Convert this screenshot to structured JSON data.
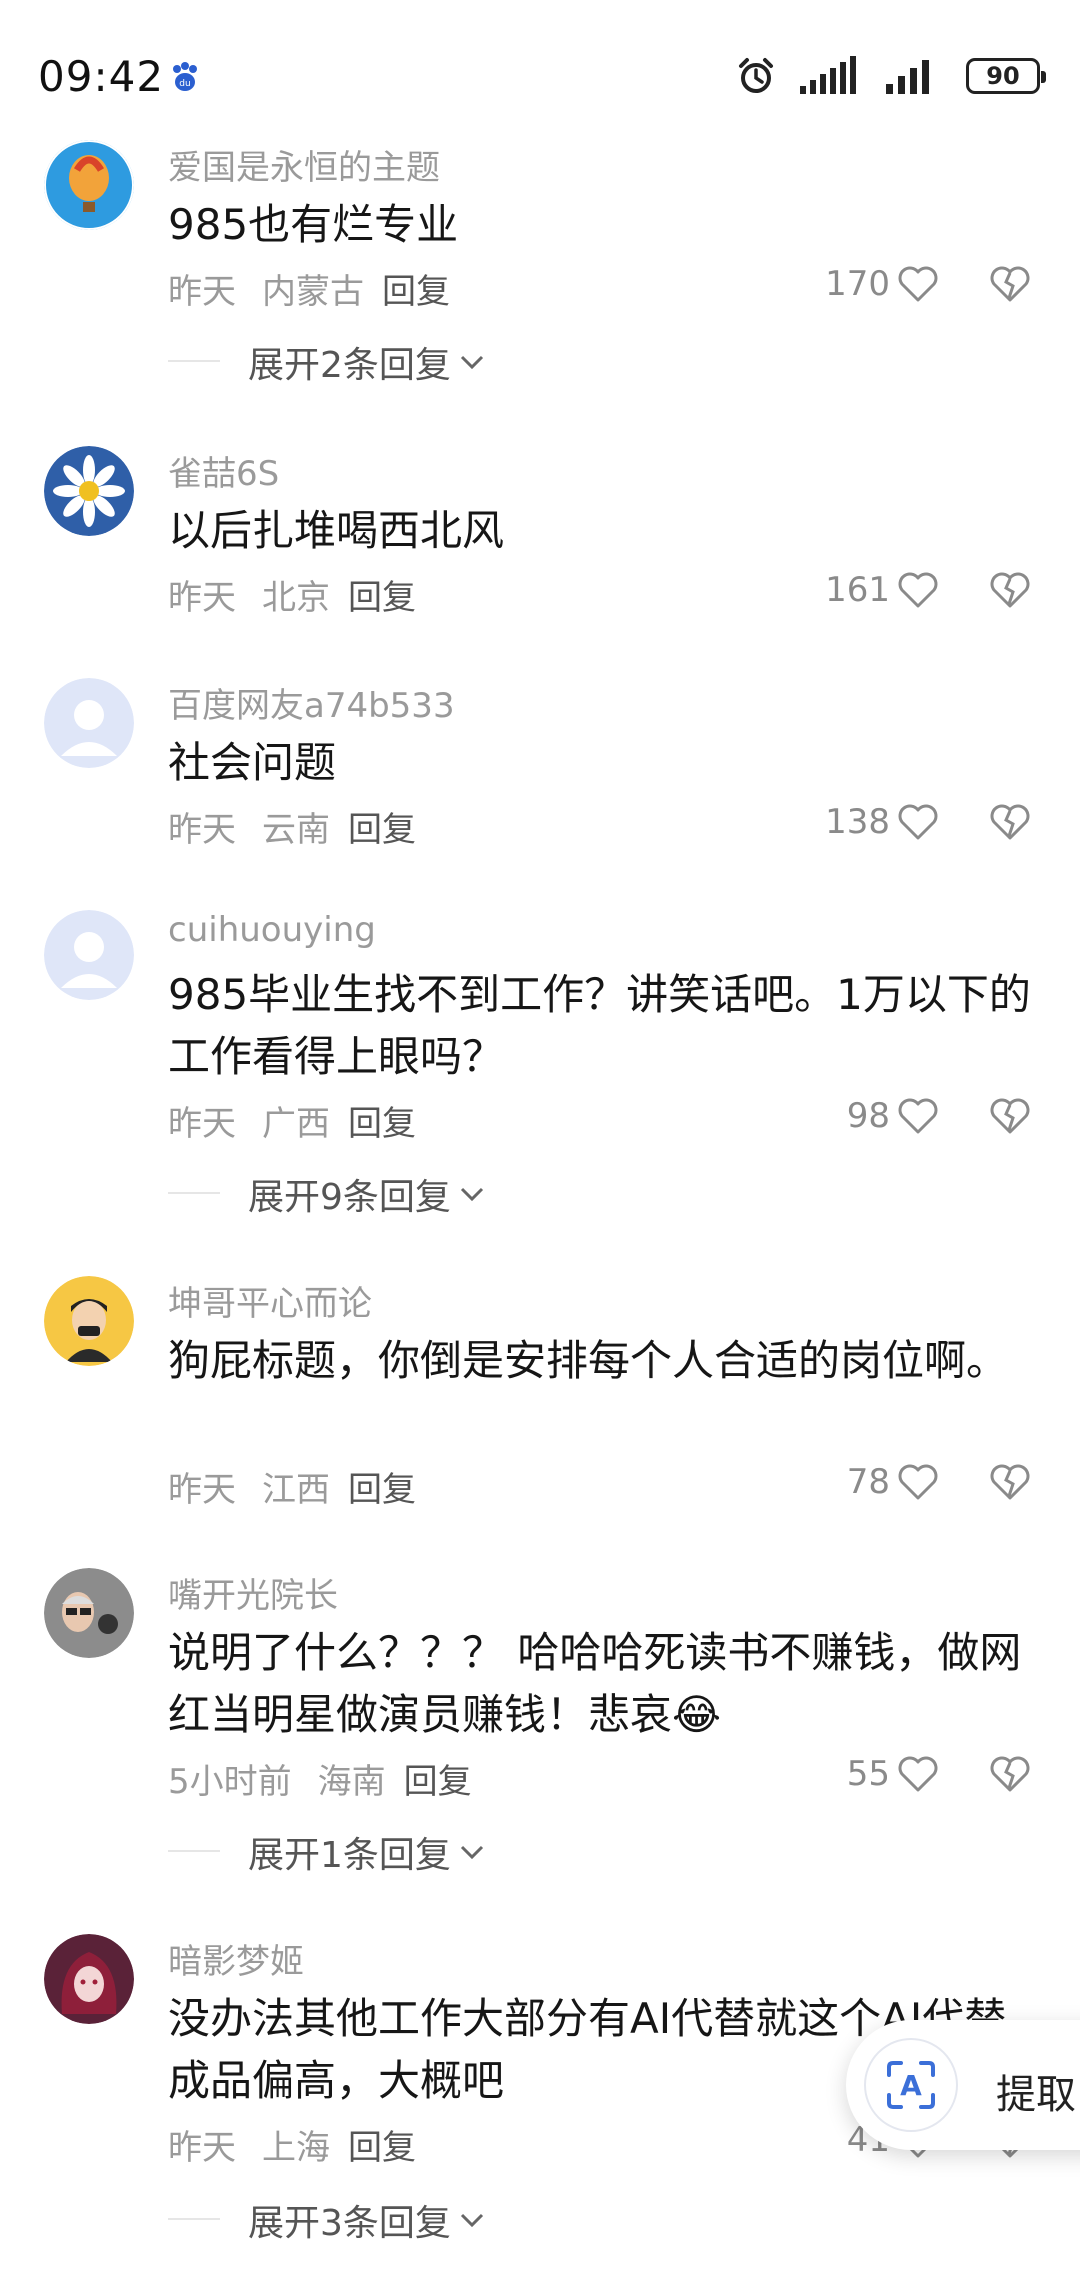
{
  "status_bar": {
    "time": "09:42",
    "battery": "90"
  },
  "comments": [
    {
      "username": "爱国是永恒的主题",
      "text": "985也有烂专业",
      "time": "昨天",
      "location": "内蒙古",
      "reply_label": "回复",
      "likes": "170",
      "expand": "展开2条回复"
    },
    {
      "username": "雀喆6S",
      "text": "以后扎堆喝西北风",
      "time": "昨天",
      "location": "北京",
      "reply_label": "回复",
      "likes": "161"
    },
    {
      "username": "百度网友a74b533",
      "text": "社会问题",
      "time": "昨天",
      "location": "云南",
      "reply_label": "回复",
      "likes": "138"
    },
    {
      "username": "cuihuouying",
      "text": "985毕业生找不到工作？讲笑话吧。1万以下的工作看得上眼吗？",
      "time": "昨天",
      "location": "广西",
      "reply_label": "回复",
      "likes": "98",
      "expand": "展开9条回复"
    },
    {
      "username": "坤哥平心而论",
      "text": "狗屁标题，你倒是安排每个人合适的岗位啊。",
      "time": "昨天",
      "location": "江西",
      "reply_label": "回复",
      "likes": "78"
    },
    {
      "username": "嘴开光院长",
      "text": "说明了什么？？？ 哈哈哈死读书不赚钱，做网红当明星做演员赚钱！悲哀😂",
      "time": "5小时前",
      "location": "海南",
      "reply_label": "回复",
      "likes": "55",
      "expand": "展开1条回复"
    },
    {
      "username": "暗影梦姬",
      "text": "没办法其他工作大部分有AI代替就这个AI代替成品偏高，大概吧",
      "time": "昨天",
      "location": "上海",
      "reply_label": "回复",
      "likes": "41",
      "expand": "展开3条回复"
    }
  ],
  "floating_tool": {
    "label": "提取",
    "icon": "text-recognition-icon"
  },
  "colors": {
    "meta_gray": "#9a9a9a",
    "text": "#161616",
    "accent_blue": "#3b6fd8"
  }
}
